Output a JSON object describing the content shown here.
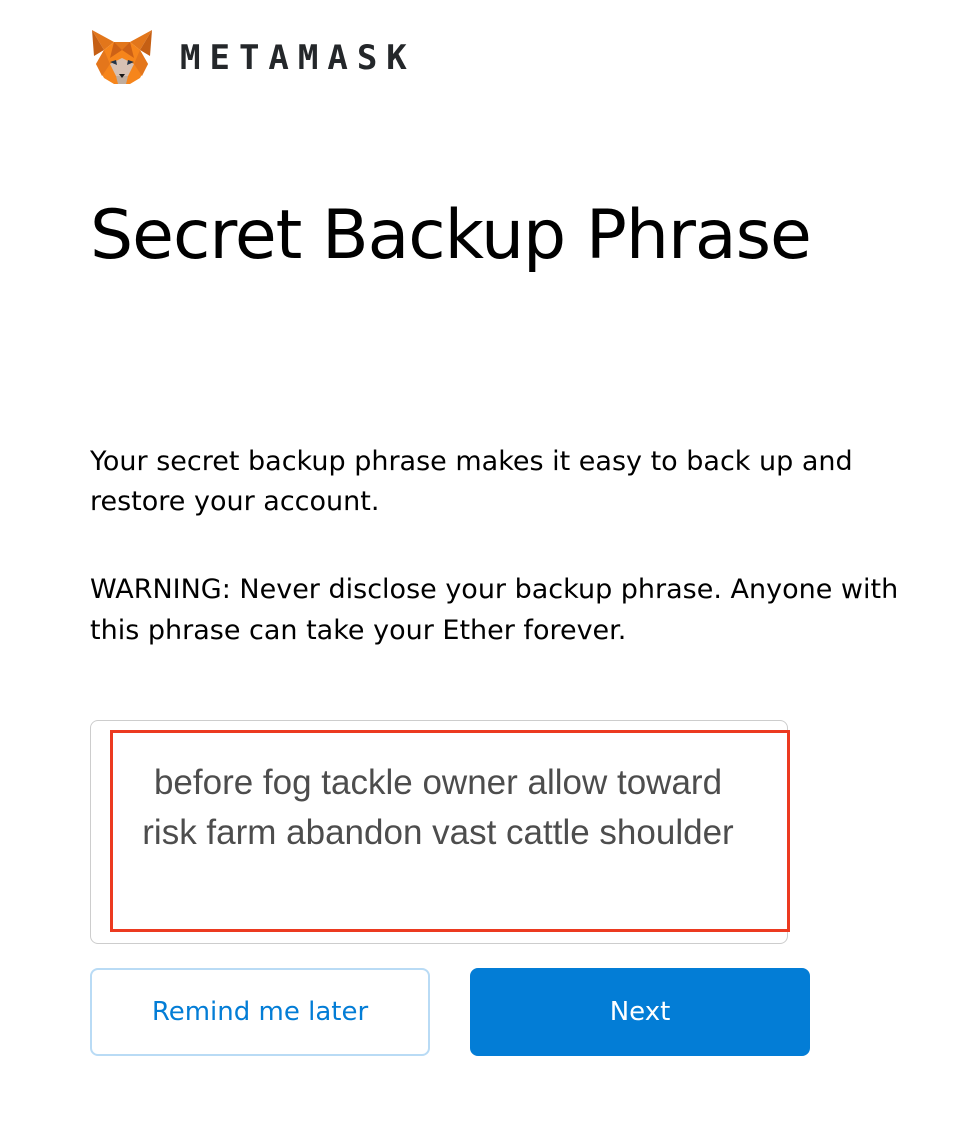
{
  "header": {
    "logo_icon": "metamask-fox-icon",
    "wordmark": "METAMASK"
  },
  "main": {
    "title": "Secret Backup Phrase",
    "description": "Your secret backup phrase makes it easy to back up and restore your account.",
    "warning": "WARNING: Never disclose your backup phrase. Anyone with this phrase can take your Ether forever.",
    "secret_phrase": "before fog tackle owner allow toward risk farm abandon vast cattle shoulder"
  },
  "buttons": {
    "remind_label": "Remind me later",
    "next_label": "Next"
  },
  "colors": {
    "accent_blue": "#037dd6",
    "secondary_border": "#b9dbf5",
    "highlight_red": "#ec3a20",
    "fox_orange": "#e2761b"
  }
}
